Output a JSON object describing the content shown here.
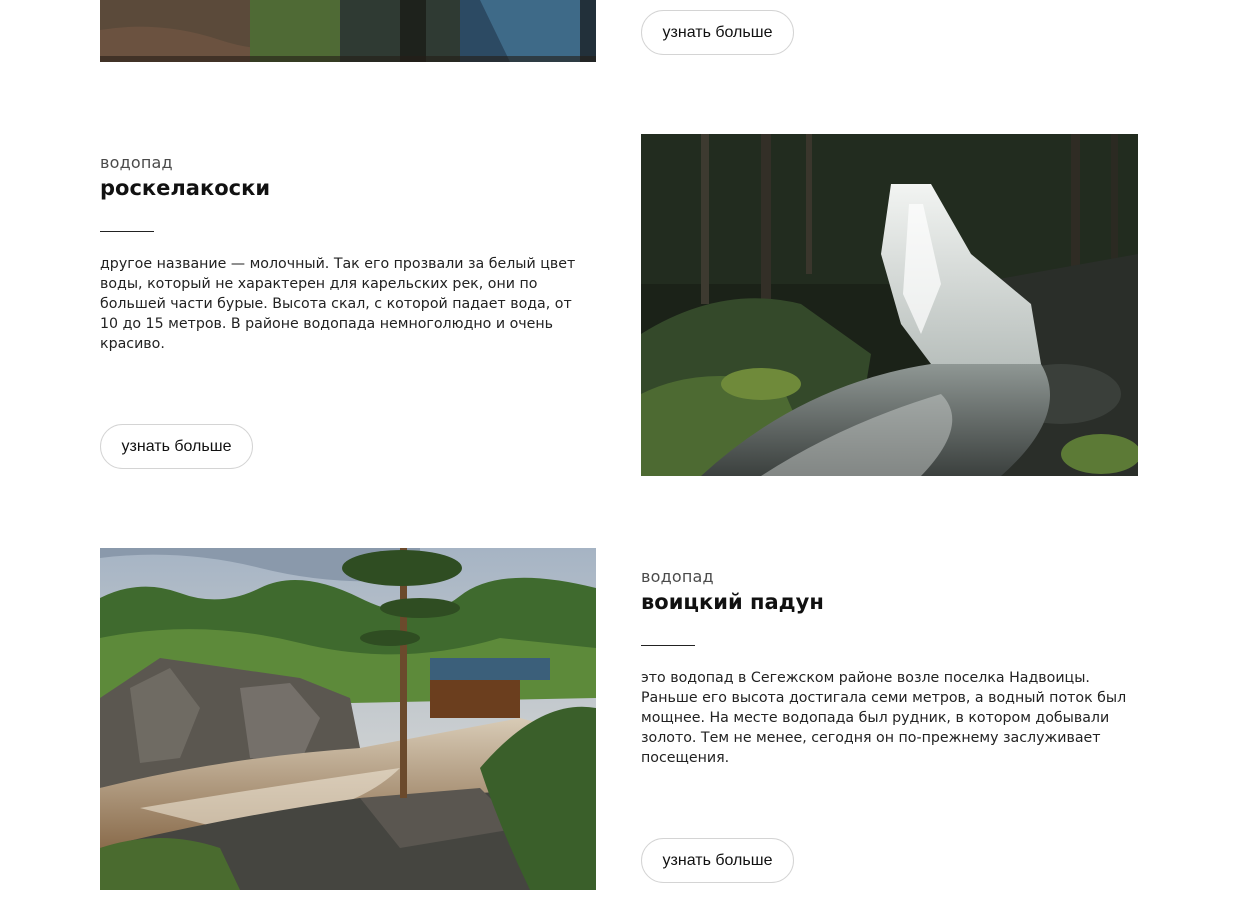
{
  "cards": [
    {
      "button_label": "узнать больше"
    },
    {
      "eyebrow": "водопад",
      "title": "роскелакоски",
      "description": "другое название — молочный. Так его прозвали за белый цвет воды, который не характерен для карельских рек, они по большей части бурые. Высота скал, с которой падает вода, от 10 до 15 метров. В районе водопада немноголюдно и очень красиво.",
      "button_label": "узнать больше",
      "image_subject": "waterfall in dark forest"
    },
    {
      "eyebrow": "водопад",
      "title": "воицкий падун",
      "description": "это водопад в Сегежском районе возле поселка Надвоицы. Раньше его высота достигала семи метров, а водный поток был мощнее. На месте водопада был рудник, в котором добывали золото. Тем не менее, сегодня он по-прежнему заслуживает посещения.",
      "button_label": "узнать больше",
      "image_subject": "rocky rapids with pine tree"
    }
  ],
  "colors": {
    "text": "#1a1a1a",
    "button_border": "#d4d4d4",
    "background": "#ffffff"
  }
}
